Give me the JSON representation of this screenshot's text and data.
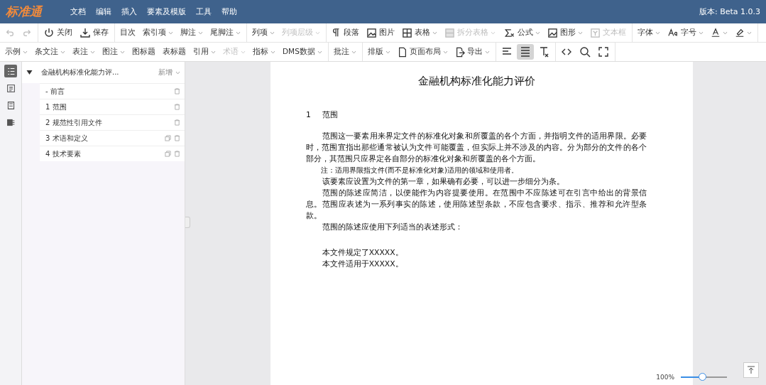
{
  "header": {
    "logo": "标准通",
    "menu": [
      "文档",
      "编辑",
      "插入",
      "要素及模版",
      "工具",
      "帮助"
    ],
    "version": "版本: Beta 1.0.3"
  },
  "toolbar": [
    [
      [
        {
          "disabled": true,
          "dropdown": false
        },
        {
          "disabled": true,
          "dropdown": false
        }
      ],
      [
        {
          "label": "关闭",
          "disabled": false,
          "dropdown": false
        },
        {
          "label": "保存",
          "disabled": false,
          "dropdown": false
        }
      ],
      [
        {
          "label": "目次",
          "disabled": false,
          "dropdown": false
        },
        {
          "label": "索引项",
          "disabled": false,
          "dropdown": true
        },
        {
          "label": "脚注",
          "disabled": false,
          "dropdown": true
        },
        {
          "label": "尾脚注",
          "disabled": false,
          "dropdown": true
        }
      ],
      [
        {
          "label": "列项",
          "disabled": false,
          "dropdown": true
        },
        {
          "label": "列项层级",
          "disabled": true,
          "dropdown": true
        }
      ],
      [
        {
          "label": "段落",
          "disabled": false,
          "dropdown": false
        },
        {
          "label": "图片",
          "disabled": false,
          "dropdown": false
        },
        {
          "label": "表格",
          "disabled": false,
          "dropdown": true
        },
        {
          "label": "拆分表格",
          "disabled": true,
          "dropdown": true
        },
        {
          "label": "公式",
          "disabled": false,
          "dropdown": true
        },
        {
          "label": "图形",
          "disabled": false,
          "dropdown": true
        },
        {
          "label": "文本框",
          "disabled": true,
          "dropdown": false
        }
      ],
      [
        {
          "label": "字体",
          "disabled": false,
          "dropdown": true
        },
        {
          "label": "字号",
          "disabled": false,
          "dropdown": true
        },
        {
          "disabled": false,
          "dropdown": true
        },
        {
          "disabled": false,
          "dropdown": true
        }
      ]
    ],
    [
      [
        {
          "label": "示例",
          "disabled": false,
          "dropdown": true
        },
        {
          "label": "条文注",
          "disabled": false,
          "dropdown": true
        },
        {
          "label": "表注",
          "disabled": false,
          "dropdown": true
        },
        {
          "label": "图注",
          "disabled": false,
          "dropdown": true
        },
        {
          "label": "图标题",
          "disabled": false,
          "dropdown": false
        },
        {
          "label": "表标题",
          "disabled": false,
          "dropdown": false
        },
        {
          "label": "引用",
          "disabled": false,
          "dropdown": true
        },
        {
          "label": "术语",
          "disabled": true,
          "dropdown": true
        },
        {
          "label": "指标",
          "disabled": false,
          "dropdown": true
        },
        {
          "label": "DMS数据",
          "disabled": false,
          "dropdown": true
        }
      ],
      [
        {
          "label": "批注",
          "disabled": false,
          "dropdown": true
        }
      ],
      [
        {
          "label": "排版",
          "disabled": false,
          "dropdown": true
        },
        {
          "label": "页面布局",
          "disabled": false,
          "dropdown": true
        },
        {
          "label": "导出",
          "disabled": false,
          "dropdown": true
        }
      ],
      [
        {
          "disabled": false,
          "dropdown": false,
          "selected": false
        },
        {
          "disabled": false,
          "dropdown": false,
          "selected": true
        },
        {
          "disabled": false,
          "dropdown": false,
          "selected": false
        }
      ],
      [
        {
          "disabled": false,
          "dropdown": false
        },
        {
          "disabled": false,
          "dropdown": false
        },
        {
          "disabled": false,
          "dropdown": false
        }
      ]
    ]
  ],
  "rail": [
    {
      "selected": true
    },
    {
      "selected": false
    },
    {
      "selected": false
    },
    {
      "selected": false
    }
  ],
  "outline": {
    "title": "金融机构标准化能力评...",
    "action": "新增",
    "expanded": true,
    "children": [
      {
        "label": "- 前言",
        "kind": "fixed"
      },
      {
        "label": "1 范围",
        "kind": "fixed"
      },
      {
        "label": "2 规范性引用文件",
        "kind": "fixed"
      },
      {
        "label": "3 术语和定义",
        "kind": "element"
      },
      {
        "label": "4 技术要素",
        "kind": "element"
      }
    ]
  },
  "document": {
    "title": "金融机构标准化能力评价",
    "heading": {
      "number": "1",
      "text": "范围"
    },
    "paragraphs": [
      {
        "kind": "text",
        "text": "范围这一要素用来界定文件的标准化对象和所覆盖的各个方面，并指明文件的适用界限。必要时，范围宜指出那些通常被认为文件可能覆盖，但实际上并不涉及的内容。分为部分的文件的各个部分，其范围只应界定各自部分的标准化对象和所覆盖的各个方面。"
      },
      {
        "kind": "note",
        "text": "注：适用界限指文件(而不是标准化对象)适用的领域和使用者。"
      },
      {
        "kind": "text",
        "text": "该要素应设置为文件的第一章，如果确有必要，可以进一步细分为条。"
      },
      {
        "kind": "text",
        "text": "范围的陈述应简洁，以便能作为内容提要使用。在范围中不应陈述可在引言中给出的背景信息。范围应表述为一系列事实的陈述，使用陈述型条款，不应包含要求、指示、推荐和允许型条款。"
      },
      {
        "kind": "text",
        "text": "范围的陈述应使用下列适当的表述形式："
      },
      {
        "kind": "gap",
        "text": "本文件规定了XXXXX。"
      },
      {
        "kind": "text",
        "text": "本文件适用于XXXXX。"
      }
    ]
  },
  "zoom": {
    "reading": "100%",
    "level": 0.5
  }
}
